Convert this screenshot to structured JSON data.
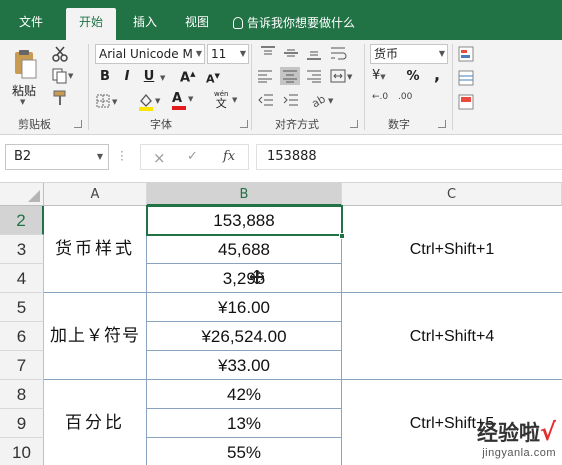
{
  "tabs": [
    {
      "label": "文件"
    },
    {
      "label": "开始"
    },
    {
      "label": "插入"
    },
    {
      "label": "视图"
    }
  ],
  "tell_me": "告诉我你想要做什么",
  "ribbon": {
    "groups": {
      "clipboard": "剪贴板",
      "font": "字体",
      "alignment": "对齐方式",
      "number": "数字"
    },
    "paste_label": "粘贴",
    "font_name": "Arial Unicode M",
    "font_size": "11",
    "number_format": "货币",
    "bold": "B",
    "italic": "I",
    "underline": "U",
    "percent": "%",
    "comma": ",",
    "font_color": "#e31b1b",
    "fill_color": "#ffe600",
    "wen_label": "wén",
    "wen_char": "文",
    "font_grow": "A",
    "font_shrink": "A",
    "font_color_letter": "A",
    "currency_symbol": "¥",
    "dec_inc": "←.0",
    "dec_dec": ".00"
  },
  "formula_bar": {
    "name_box": "B2",
    "cancel": "×",
    "enter": "✓",
    "fx": "fx",
    "formula": "153888"
  },
  "sheet": {
    "columns": [
      "A",
      "B",
      "C"
    ],
    "selected_column": "B",
    "rows": [
      "2",
      "3",
      "4",
      "5",
      "6",
      "7",
      "8",
      "9",
      "10"
    ],
    "selected_row": "2",
    "groups": [
      {
        "label": "货币样式",
        "shortcut": "Ctrl+Shift+1",
        "values": [
          "153,888",
          "45,688",
          "3,295"
        ]
      },
      {
        "label": "加上￥符号",
        "shortcut": "Ctrl+Shift+4",
        "values": [
          "¥16.00",
          "¥26,524.00",
          "¥33.00"
        ]
      },
      {
        "label": "百分比",
        "shortcut": "Ctrl+Shift+5",
        "values": [
          "42%",
          "13%",
          "55%"
        ]
      }
    ]
  },
  "watermark": {
    "brand": "经验啦",
    "check": "√",
    "url": "jingyanla.com"
  },
  "colors": {
    "excel_green": "#217346",
    "gridline_blue": "#8aa3c0"
  }
}
